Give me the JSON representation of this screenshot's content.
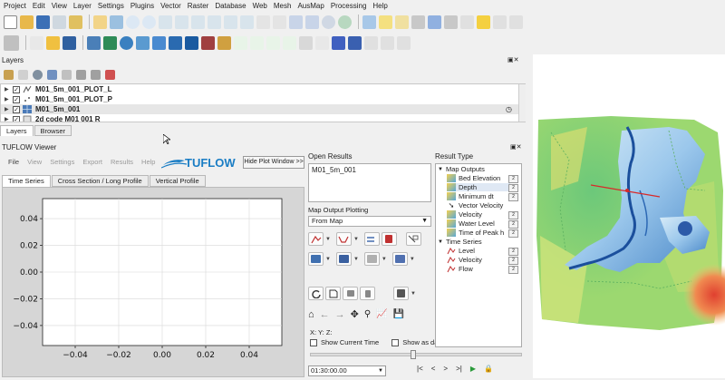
{
  "menubar": {
    "items": [
      "Project",
      "Edit",
      "View",
      "Layer",
      "Settings",
      "Plugins",
      "Vector",
      "Raster",
      "Database",
      "Web",
      "Mesh",
      "AusMap",
      "Processing",
      "Help"
    ]
  },
  "layers_panel": {
    "title": "Layers",
    "layers": [
      {
        "name": "M01_5m_001_PLOT_L",
        "checked": true,
        "bold": true,
        "icon": "line-layer-icon"
      },
      {
        "name": "M01_5m_001_PLOT_P",
        "checked": true,
        "bold": true,
        "icon": "point-layer-icon"
      },
      {
        "name": "M01_5m_001",
        "checked": true,
        "bold": true,
        "icon": "mesh-layer-icon",
        "selected": true
      },
      {
        "name": "2d code M01 001 R",
        "checked": true,
        "bold": true,
        "icon": "polygon-layer-icon"
      }
    ],
    "tabs": [
      "Layers",
      "Browser"
    ]
  },
  "tuflow_viewer": {
    "title": "TUFLOW Viewer",
    "menu": [
      "File",
      "View",
      "Settings",
      "Export",
      "Results",
      "Help"
    ],
    "logo_text": "TUFLOW",
    "hide_button": "Hide Plot Window >>",
    "plot_tabs": [
      "Time Series",
      "Cross Section / Long Profile",
      "Vertical Profile"
    ]
  },
  "open_results": {
    "label": "Open Results",
    "items": [
      "M01_5m_001"
    ]
  },
  "map_output_plotting": {
    "label": "Map Output Plotting",
    "selected": "From Map"
  },
  "coords": {
    "x": "X:",
    "y": "Y:",
    "z": "Z:"
  },
  "options": {
    "show_current_time": "Show Current Time",
    "show_as_dates": "Show as dates"
  },
  "result_type": {
    "label": "Result Type",
    "groups": [
      {
        "name": "Map Outputs",
        "items": [
          "Bed Elevation",
          "Depth",
          "Minimum dt",
          "Vector Velocity",
          "Velocity",
          "Water Level",
          "Time of Peak h"
        ]
      },
      {
        "name": "Time Series",
        "items": [
          "Level",
          "Velocity",
          "Flow"
        ]
      }
    ]
  },
  "time": {
    "current": "01:30:00.00"
  },
  "chart_data": {
    "type": "line",
    "title": "",
    "xlabel": "",
    "ylabel": "",
    "xlim": [
      -0.055,
      0.055
    ],
    "ylim": [
      -0.055,
      0.055
    ],
    "x_ticks": [
      "−0.04",
      "−0.02",
      "0.00",
      "0.02",
      "0.04"
    ],
    "y_ticks": [
      "0.04",
      "0.02",
      "0.00",
      "−0.02",
      "−0.04"
    ],
    "x_tick_values": [
      -0.04,
      -0.02,
      0,
      0.02,
      0.04
    ],
    "y_tick_values": [
      0.04,
      0.02,
      0,
      -0.02,
      -0.04
    ],
    "series": [],
    "grid": true
  },
  "colors": {
    "accent": "#2b6cb0",
    "logo_blue": "#1a7dc4",
    "depth_dark": "#1b4f9c",
    "map_green": "#58c070"
  }
}
